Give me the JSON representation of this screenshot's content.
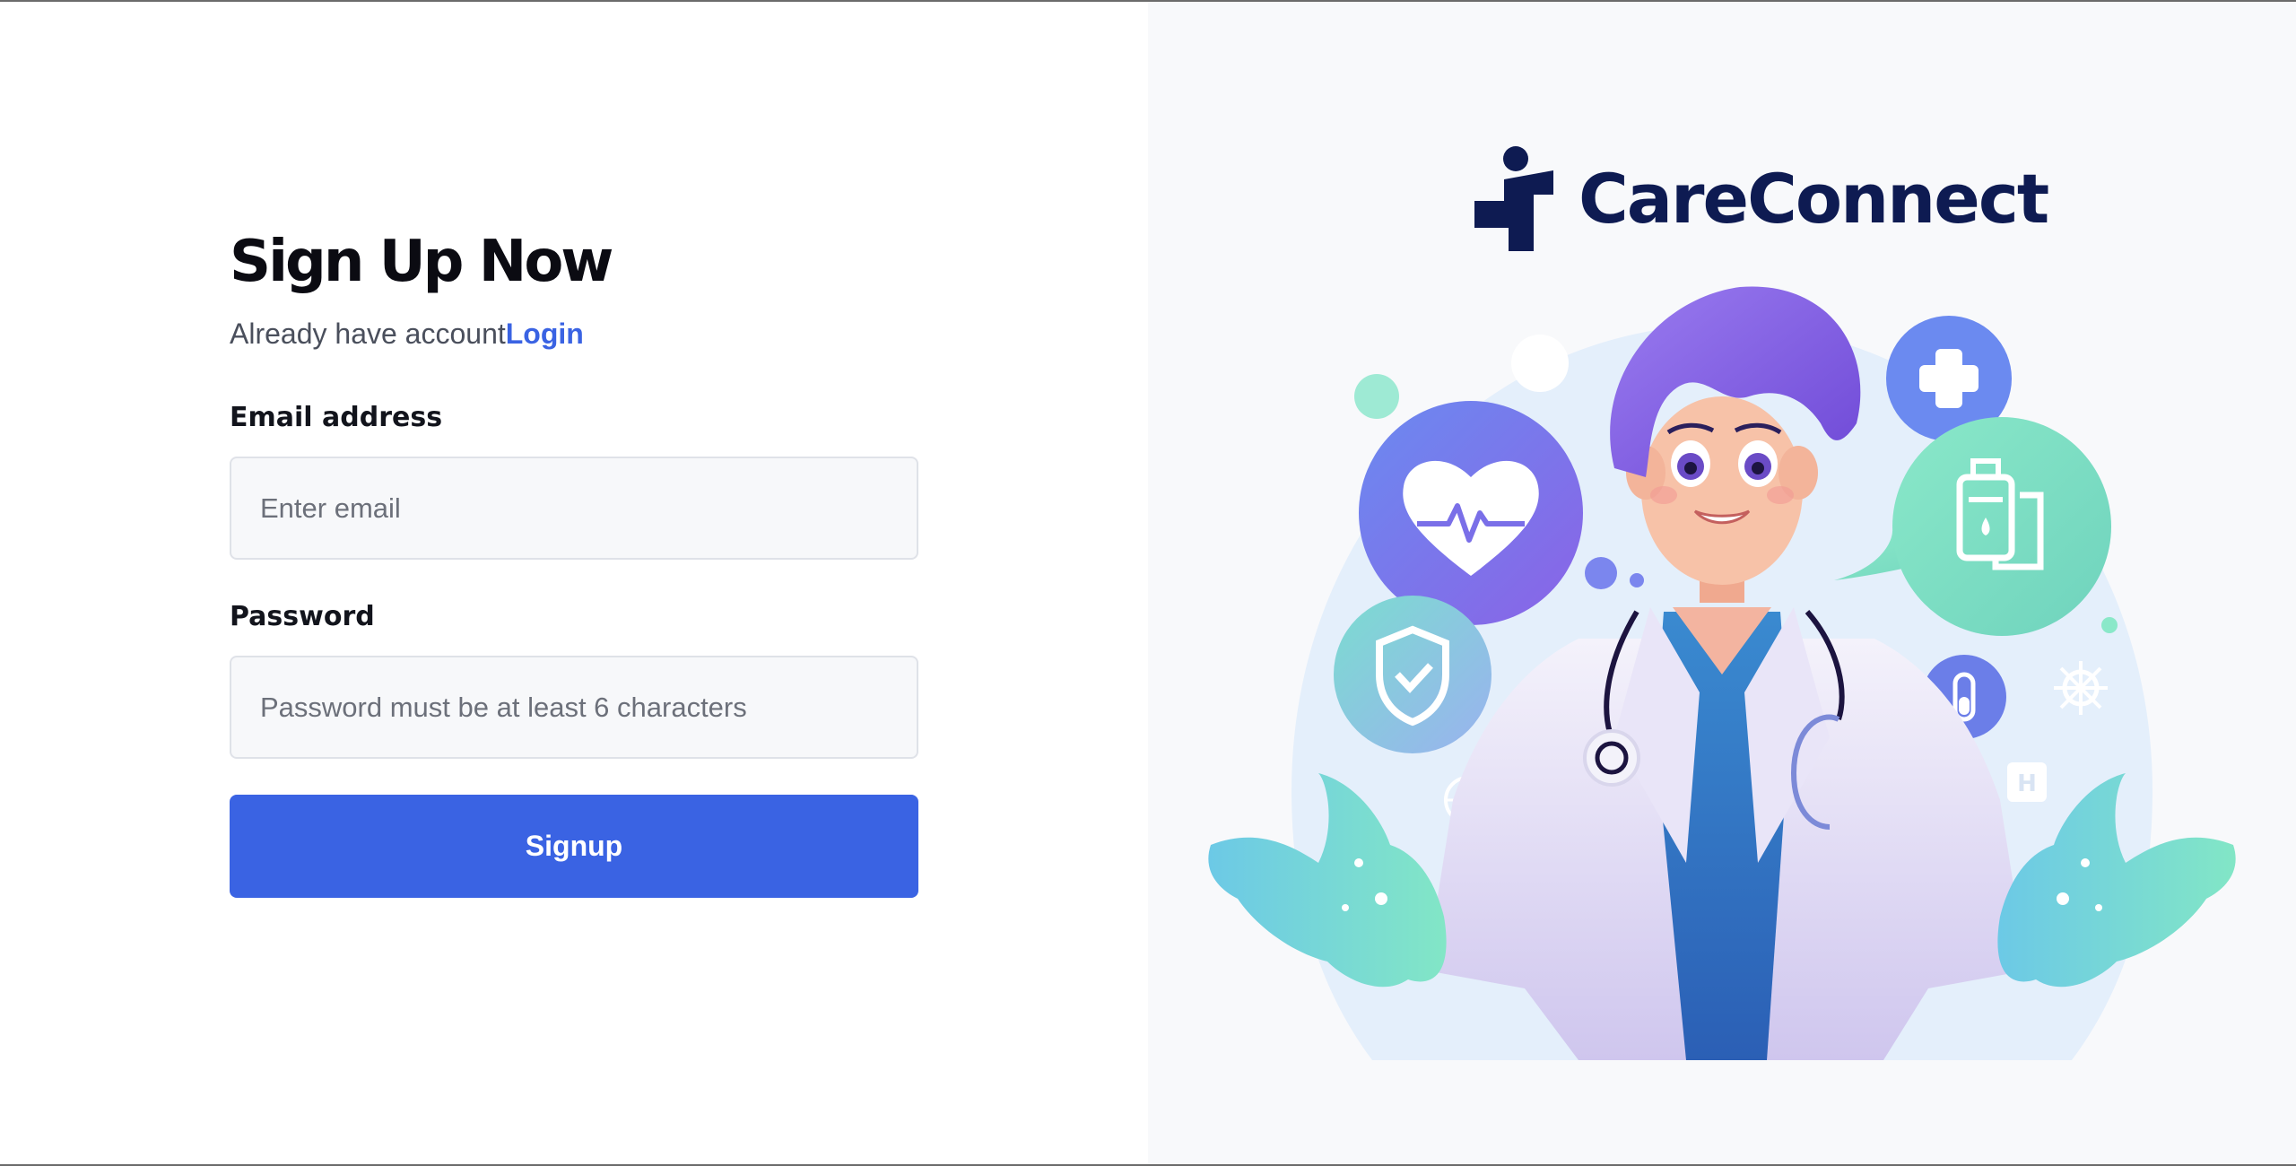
{
  "signup": {
    "title": "Sign Up Now",
    "already_text": "Already have account",
    "login_link": "Login",
    "email_label": "Email address",
    "email_placeholder": "Enter email",
    "email_value": "",
    "password_label": "Password",
    "password_placeholder": "Password must be at least 6 characters",
    "password_value": "",
    "submit_label": "Signup"
  },
  "brand": {
    "name": "CareConnect",
    "logo_icon": "medical-cross-person-icon"
  },
  "illustration": {
    "subject": "doctor-illustration",
    "icons": [
      "heart-pulse-icon",
      "medical-cross-icon",
      "iv-bag-icon",
      "shield-check-icon",
      "test-tube-icon",
      "globe-icon",
      "hospital-icon",
      "virus-icon"
    ]
  },
  "colors": {
    "accent": "#3a63e3",
    "brand": "#0e1b52",
    "panel_bg": "#f8f9fb"
  }
}
